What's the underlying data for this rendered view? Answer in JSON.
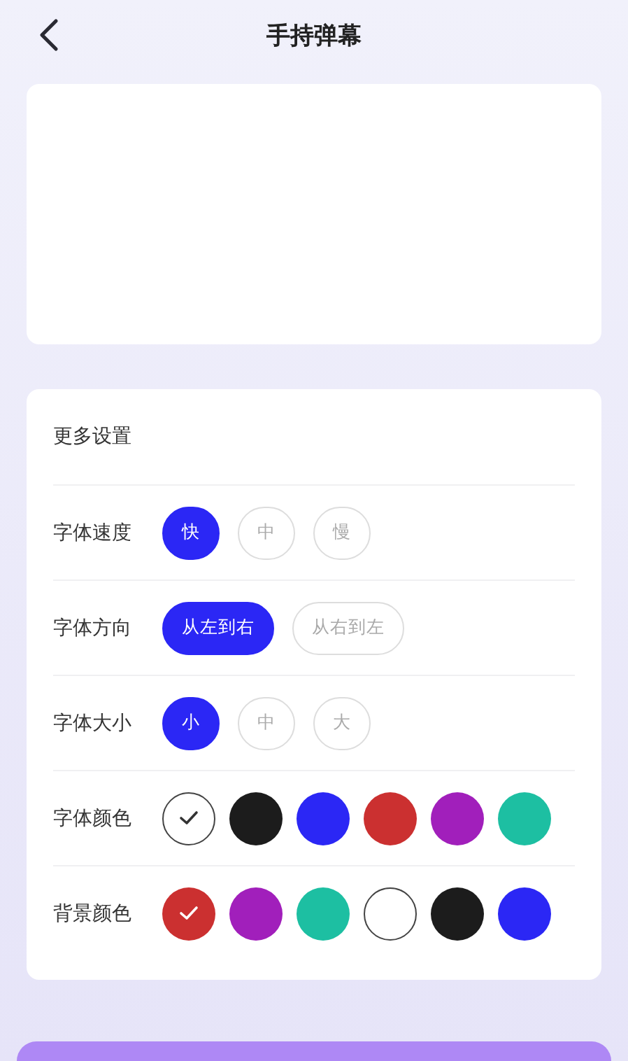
{
  "header": {
    "title": "手持弹幕"
  },
  "settings": {
    "title": "更多设置",
    "rows": [
      {
        "kind": "chips",
        "label": "字体速度",
        "options": [
          {
            "label": "快",
            "selected": true
          },
          {
            "label": "中",
            "selected": false
          },
          {
            "label": "慢",
            "selected": false
          }
        ]
      },
      {
        "kind": "chips",
        "label": "字体方向",
        "options": [
          {
            "label": "从左到右",
            "selected": true
          },
          {
            "label": "从右到左",
            "selected": false
          }
        ]
      },
      {
        "kind": "chips",
        "label": "字体大小",
        "options": [
          {
            "label": "小",
            "selected": true
          },
          {
            "label": "中",
            "selected": false
          },
          {
            "label": "大",
            "selected": false
          }
        ]
      },
      {
        "kind": "colors",
        "label": "字体颜色",
        "options": [
          {
            "color": "#ffffff",
            "selected": true
          },
          {
            "color": "#1c1c1c",
            "selected": false
          },
          {
            "color": "#2b27f5",
            "selected": false
          },
          {
            "color": "#cb3030",
            "selected": false
          },
          {
            "color": "#a11fbb",
            "selected": false
          },
          {
            "color": "#1dbfa2",
            "selected": false
          }
        ]
      },
      {
        "kind": "colors",
        "label": "背景颜色",
        "options": [
          {
            "color": "#cb3030",
            "selected": true
          },
          {
            "color": "#a11fbb",
            "selected": false
          },
          {
            "color": "#1dbfa2",
            "selected": false
          },
          {
            "color": "#ffffff",
            "selected": false
          },
          {
            "color": "#1c1c1c",
            "selected": false
          },
          {
            "color": "#2b27f5",
            "selected": false
          }
        ]
      }
    ]
  }
}
